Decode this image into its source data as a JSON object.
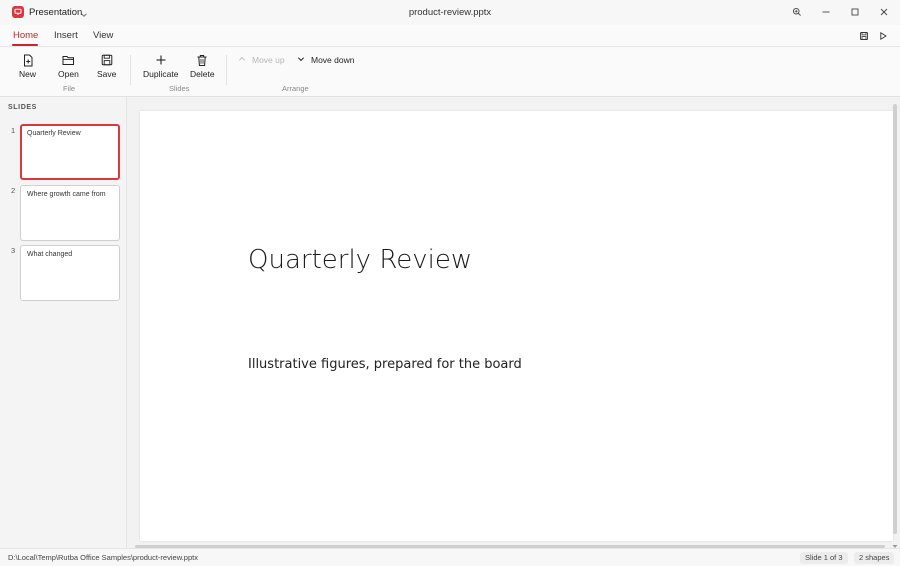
{
  "app": {
    "name": "Presentation",
    "document_title": "product-review.pptx"
  },
  "tabs": [
    {
      "label": "Home",
      "active": true
    },
    {
      "label": "Insert",
      "active": false
    },
    {
      "label": "View",
      "active": false
    }
  ],
  "ribbon": {
    "file": {
      "group_label": "File",
      "new_label": "New",
      "open_label": "Open",
      "save_label": "Save"
    },
    "slides": {
      "group_label": "Slides",
      "duplicate_label": "Duplicate",
      "delete_label": "Delete"
    },
    "arrange": {
      "group_label": "Arrange",
      "move_up_label": "Move up",
      "move_down_label": "Move down"
    }
  },
  "slides_panel": {
    "header": "SLIDES",
    "items": [
      {
        "number": "1",
        "title": "Quarterly Review",
        "selected": true
      },
      {
        "number": "2",
        "title": "Where growth came from",
        "selected": false
      },
      {
        "number": "3",
        "title": "What changed",
        "selected": false
      }
    ]
  },
  "current_slide": {
    "title": "Quarterly Review",
    "subtitle": "Illustrative figures, prepared for the board"
  },
  "status": {
    "path": "D:\\Local\\Temp\\Rutba Office Samples\\product-review.pptx",
    "slide_indicator": "Slide 1 of 3",
    "shapes": "2 shapes"
  },
  "colors": {
    "accent": "#d9383e",
    "tab_active": "#c4262e"
  },
  "icons": {
    "app": "presentation-icon",
    "zoom": "zoom-icon",
    "minimize": "minimize-icon",
    "maximize": "maximize-icon",
    "close": "close-icon",
    "save_quick": "save-icon",
    "play": "play-icon"
  }
}
